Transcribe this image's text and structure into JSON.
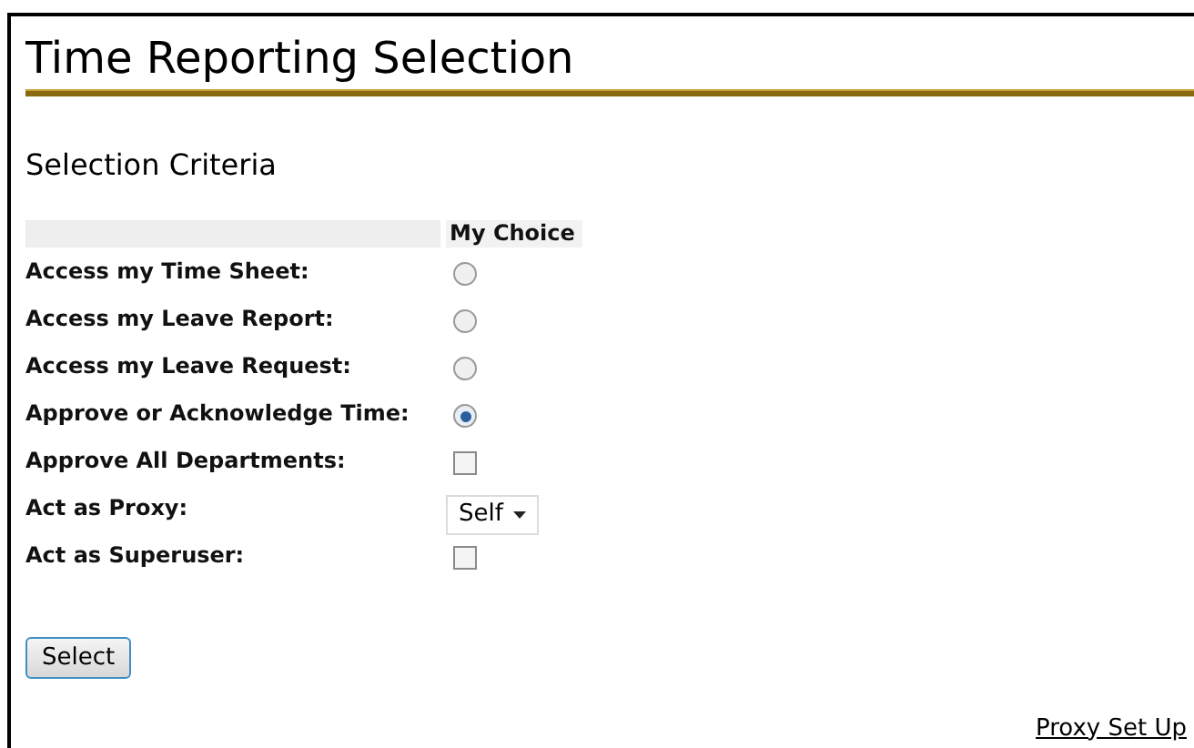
{
  "page": {
    "title": "Time Reporting Selection",
    "subtitle": "Selection Criteria"
  },
  "table": {
    "column_2": "My Choice",
    "rows": [
      {
        "label": "Access my Time Sheet:",
        "kind": "radio",
        "selected": false
      },
      {
        "label": "Access my Leave Report:",
        "kind": "radio",
        "selected": false
      },
      {
        "label": "Access my Leave Request:",
        "kind": "radio",
        "selected": false
      },
      {
        "label": "Approve or Acknowledge Time:",
        "kind": "radio",
        "selected": true
      },
      {
        "label": "Approve All Departments:",
        "kind": "checkbox",
        "checked": false
      },
      {
        "label": "Act as Proxy:",
        "kind": "select",
        "value": "Self"
      },
      {
        "label": "Act as Superuser:",
        "kind": "checkbox",
        "checked": false
      }
    ]
  },
  "buttons": [
    "Select"
  ],
  "links": [
    "Proxy Set Up"
  ]
}
